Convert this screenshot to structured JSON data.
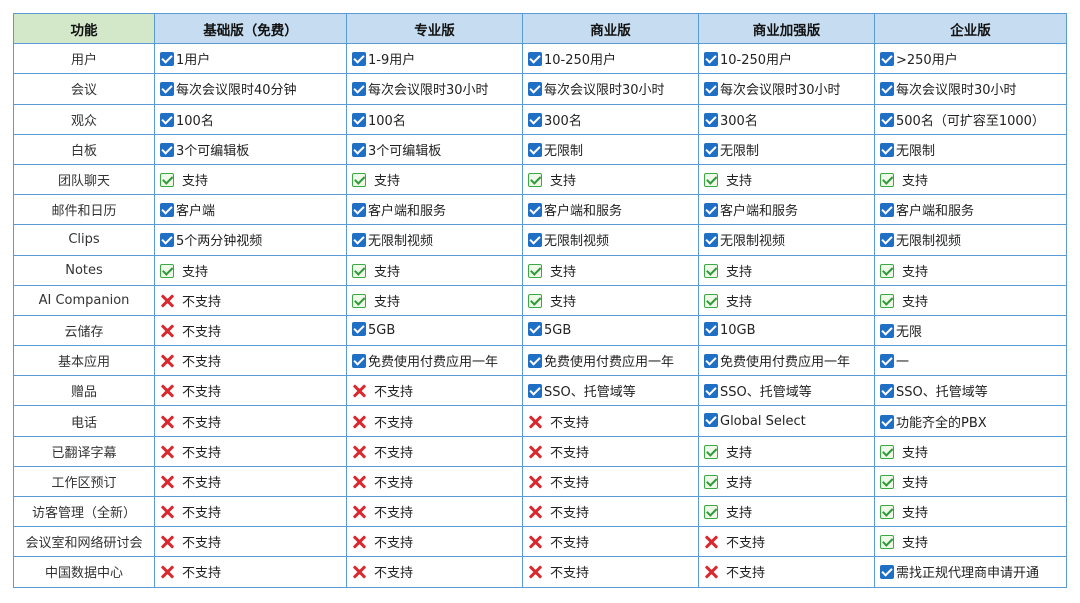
{
  "columns": [
    "功能",
    "基础版（免费）",
    "专业版",
    "商业版",
    "商业加强版",
    "企业版"
  ],
  "colors": {
    "check": "#1f6fc5",
    "support": "#3aa845",
    "cross": "#d9292e",
    "header": "#c6dcf1",
    "header_first": "#d2e8c9",
    "border": "#5b9bd5"
  },
  "icons": {
    "c": "checkbox-checked-icon",
    "s": "green-check-icon",
    "x": "red-cross-icon"
  },
  "rows": [
    {
      "feature": "用户",
      "cells": [
        [
          "c",
          "1用户"
        ],
        [
          "c",
          "1-9用户"
        ],
        [
          "c",
          "10-250用户"
        ],
        [
          "c",
          "10-250用户"
        ],
        [
          "c",
          ">250用户"
        ]
      ]
    },
    {
      "feature": "会议",
      "cells": [
        [
          "c",
          "每次会议限时40分钟"
        ],
        [
          "c",
          "每次会议限时30小时"
        ],
        [
          "c",
          "每次会议限时30小时"
        ],
        [
          "c",
          "每次会议限时30小时"
        ],
        [
          "c",
          "每次会议限时30小时"
        ]
      ]
    },
    {
      "feature": "观众",
      "cells": [
        [
          "c",
          "100名"
        ],
        [
          "c",
          "100名"
        ],
        [
          "c",
          "300名"
        ],
        [
          "c",
          "300名"
        ],
        [
          "c",
          "500名（可扩容至1000）"
        ]
      ]
    },
    {
      "feature": "白板",
      "cells": [
        [
          "c",
          "3个可编辑板"
        ],
        [
          "c",
          "3个可编辑板"
        ],
        [
          "c",
          "无限制"
        ],
        [
          "c",
          "无限制"
        ],
        [
          "c",
          "无限制"
        ]
      ]
    },
    {
      "feature": "团队聊天",
      "cells": [
        [
          "s",
          "支持"
        ],
        [
          "s",
          "支持"
        ],
        [
          "s",
          "支持"
        ],
        [
          "s",
          "支持"
        ],
        [
          "s",
          "支持"
        ]
      ]
    },
    {
      "feature": "邮件和日历",
      "cells": [
        [
          "c",
          "客户端"
        ],
        [
          "c",
          "客户端和服务"
        ],
        [
          "c",
          "客户端和服务"
        ],
        [
          "c",
          "客户端和服务"
        ],
        [
          "c",
          "客户端和服务"
        ]
      ]
    },
    {
      "feature": "Clips",
      "cells": [
        [
          "c",
          "5个两分钟视频"
        ],
        [
          "c",
          "无限制视频"
        ],
        [
          "c",
          "无限制视频"
        ],
        [
          "c",
          "无限制视频"
        ],
        [
          "c",
          "无限制视频"
        ]
      ]
    },
    {
      "feature": "Notes",
      "cells": [
        [
          "s",
          "支持"
        ],
        [
          "s",
          "支持"
        ],
        [
          "s",
          "支持"
        ],
        [
          "s",
          "支持"
        ],
        [
          "s",
          "支持"
        ]
      ]
    },
    {
      "feature": "AI Companion",
      "cells": [
        [
          "x",
          "不支持"
        ],
        [
          "s",
          "支持"
        ],
        [
          "s",
          "支持"
        ],
        [
          "s",
          "支持"
        ],
        [
          "s",
          "支持"
        ]
      ]
    },
    {
      "feature": "云储存",
      "cells": [
        [
          "x",
          "不支持"
        ],
        [
          "c",
          "5GB"
        ],
        [
          "c",
          "5GB"
        ],
        [
          "c",
          "10GB"
        ],
        [
          "c",
          "无限"
        ]
      ]
    },
    {
      "feature": "基本应用",
      "cells": [
        [
          "x",
          "不支持"
        ],
        [
          "c",
          "免费使用付费应用一年"
        ],
        [
          "c",
          "免费使用付费应用一年"
        ],
        [
          "c",
          "免费使用付费应用一年"
        ],
        [
          "c",
          "一"
        ]
      ]
    },
    {
      "feature": "赠品",
      "cells": [
        [
          "x",
          "不支持"
        ],
        [
          "x",
          "不支持"
        ],
        [
          "c",
          "SSO、托管域等"
        ],
        [
          "c",
          "SSO、托管域等"
        ],
        [
          "c",
          "SSO、托管域等"
        ]
      ]
    },
    {
      "feature": "电话",
      "cells": [
        [
          "x",
          "不支持"
        ],
        [
          "x",
          "不支持"
        ],
        [
          "x",
          "不支持"
        ],
        [
          "c",
          "Global Select"
        ],
        [
          "c",
          "功能齐全的PBX"
        ]
      ]
    },
    {
      "feature": "已翻译字幕",
      "cells": [
        [
          "x",
          "不支持"
        ],
        [
          "x",
          "不支持"
        ],
        [
          "x",
          "不支持"
        ],
        [
          "s",
          "支持"
        ],
        [
          "s",
          "支持"
        ]
      ]
    },
    {
      "feature": "工作区预订",
      "cells": [
        [
          "x",
          "不支持"
        ],
        [
          "x",
          "不支持"
        ],
        [
          "x",
          "不支持"
        ],
        [
          "s",
          "支持"
        ],
        [
          "s",
          "支持"
        ]
      ]
    },
    {
      "feature": "访客管理（全新）",
      "cells": [
        [
          "x",
          "不支持"
        ],
        [
          "x",
          "不支持"
        ],
        [
          "x",
          "不支持"
        ],
        [
          "s",
          "支持"
        ],
        [
          "s",
          "支持"
        ]
      ]
    },
    {
      "feature": "会议室和网络研讨会",
      "cells": [
        [
          "x",
          "不支持"
        ],
        [
          "x",
          "不支持"
        ],
        [
          "x",
          "不支持"
        ],
        [
          "x",
          "不支持"
        ],
        [
          "s",
          "支持"
        ]
      ]
    },
    {
      "feature": "中国数据中心",
      "cells": [
        [
          "x",
          "不支持"
        ],
        [
          "x",
          "不支持"
        ],
        [
          "x",
          "不支持"
        ],
        [
          "x",
          "不支持"
        ],
        [
          "c",
          "需找正规代理商申请开通"
        ]
      ]
    }
  ]
}
